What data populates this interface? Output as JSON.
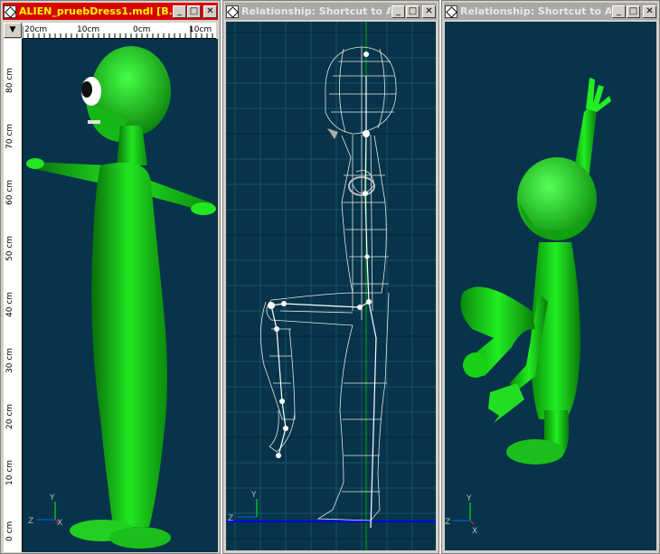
{
  "windows": [
    {
      "title": "ALIEN_pruebDress1.mdl [B...",
      "active": true
    },
    {
      "title": "Relationship: Shortcut to A...",
      "active": false
    },
    {
      "title": "Relationship: Shortcut to A...",
      "active": false
    }
  ],
  "title_buttons": {
    "minimize": "_",
    "maximize": "□",
    "close": "✕"
  },
  "ruler_top": [
    "20cm",
    "10cm",
    "0cm",
    "10cm"
  ],
  "ruler_left": [
    "80 cm",
    "70 cm",
    "60 cm",
    "50 cm",
    "40 cm",
    "30 cm",
    "20 cm",
    "10 cm",
    "0 cm"
  ],
  "dropdown": "▼",
  "axes": {
    "y": "Y",
    "z": "Z",
    "x": "X"
  },
  "colors": {
    "active_title": "#d80000",
    "inactive_title": "#a8a8a8",
    "viewport": "#07344a",
    "alien": "#18d818"
  }
}
